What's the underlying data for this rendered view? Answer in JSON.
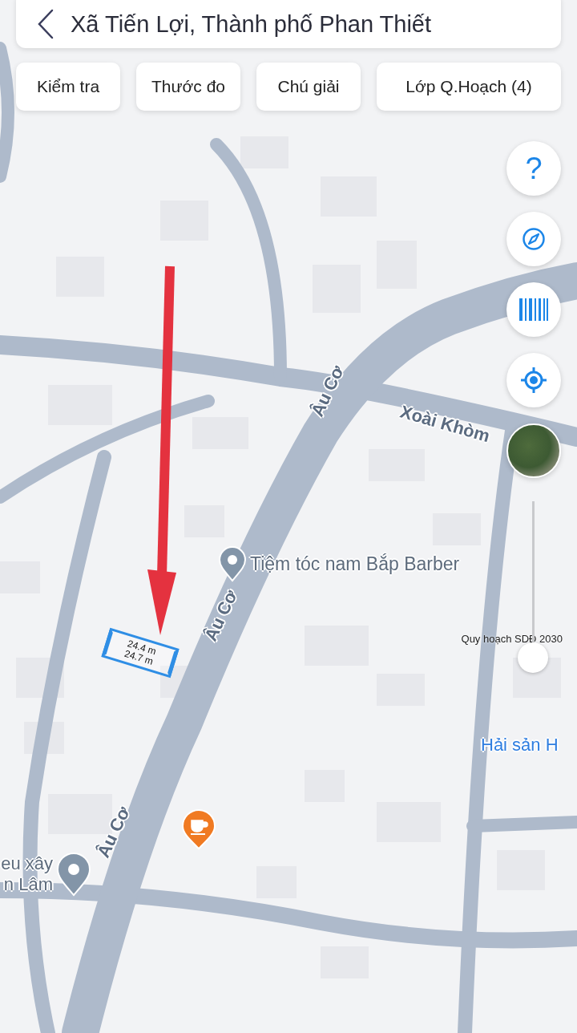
{
  "header": {
    "title": "Xã Tiến Lợi, Thành phố Phan Thiết"
  },
  "toolbar": [
    {
      "label": "Kiểm tra"
    },
    {
      "label": "Thước đo"
    },
    {
      "label": "Chú giải"
    },
    {
      "label": "Lớp Q.Hoạch (4)"
    }
  ],
  "map_controls": [
    {
      "kind": "help",
      "label": "?"
    },
    {
      "kind": "compass"
    },
    {
      "kind": "barcode"
    },
    {
      "kind": "locate"
    },
    {
      "kind": "satellite"
    }
  ],
  "layer_slider": {
    "label": "Quy hoạch SDĐ 2030",
    "level": 0
  },
  "map": {
    "street_labels": [
      "Âu Cơ",
      "Xoài Khòm",
      "Âu Cơ",
      "Âu Cơ"
    ],
    "places": [
      {
        "kind": "pin",
        "lines": [
          "Tiệm tóc nam Bắp Barber"
        ]
      },
      {
        "kind": "text",
        "lines": [
          "Hải sản H"
        ]
      },
      {
        "kind": "cafe"
      },
      {
        "kind": "pin-left",
        "lines": [
          "eu xây",
          "n Lâm"
        ]
      }
    ],
    "measurement": {
      "lengths": [
        "24.4 m",
        "24.7 m"
      ]
    }
  }
}
